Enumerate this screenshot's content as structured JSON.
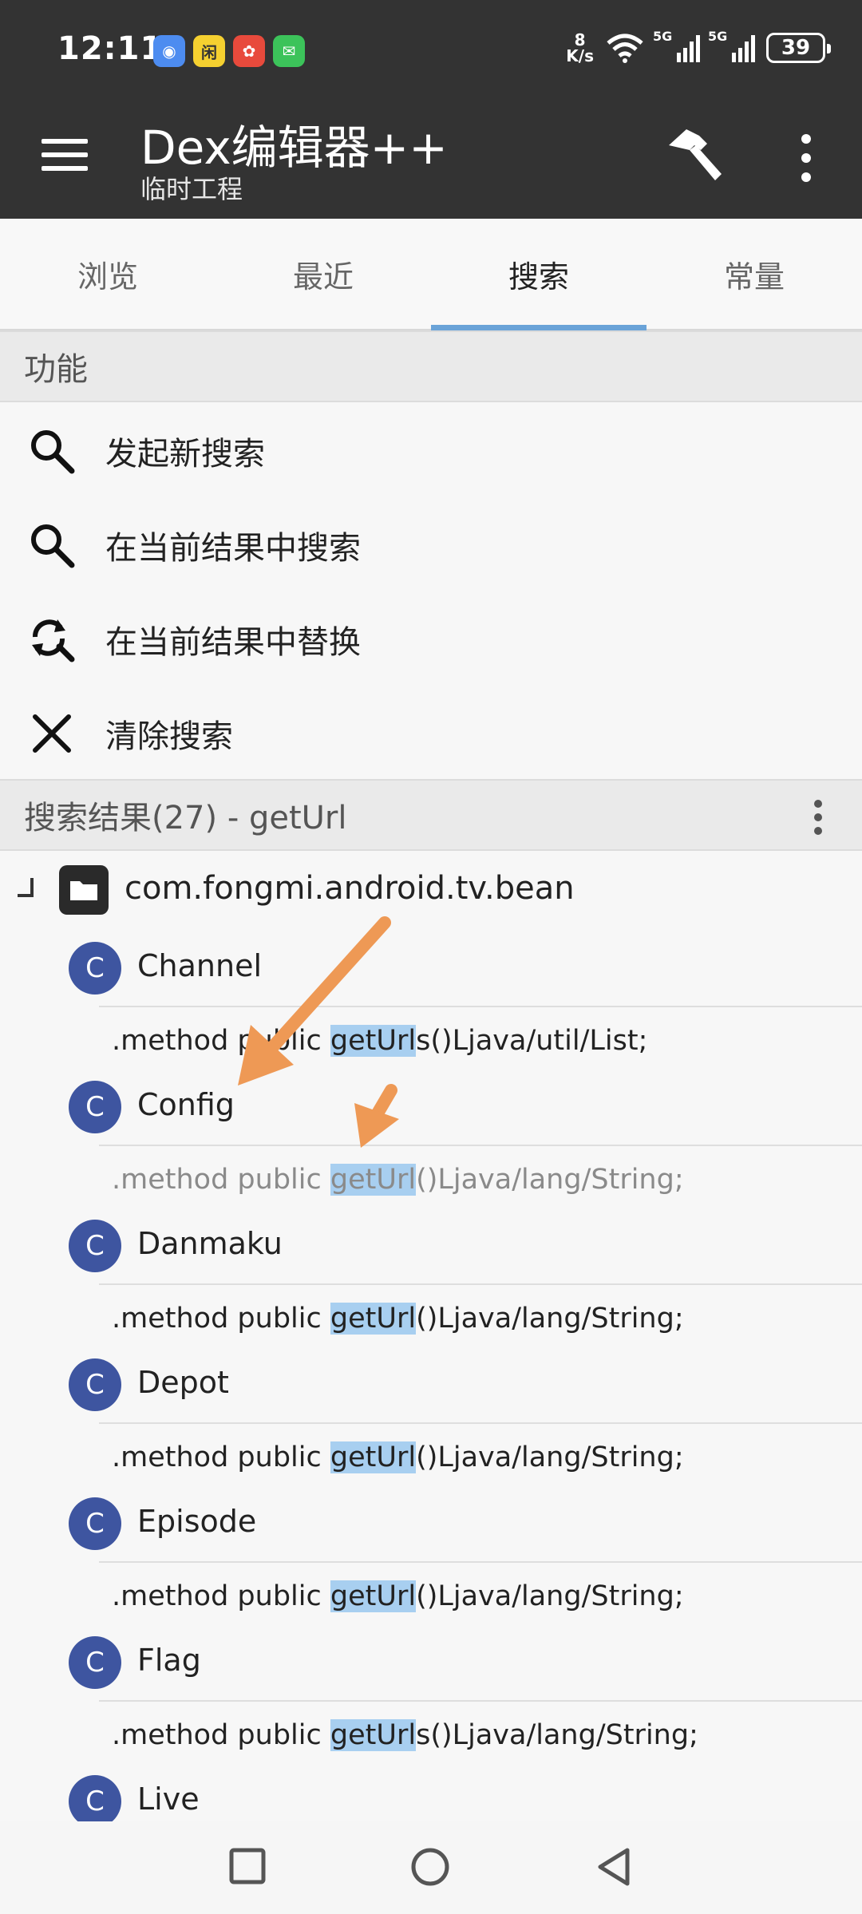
{
  "status": {
    "time": "12:11",
    "apps": [
      "◉",
      "闲",
      "✿",
      "✉"
    ],
    "net_speed_value": "8",
    "net_speed_unit": "K/s",
    "signal1": "5G",
    "signal2": "5G",
    "battery": "39"
  },
  "appbar": {
    "title": "Dex编辑器++",
    "subtitle": "临时工程"
  },
  "tabs": [
    {
      "label": "浏览"
    },
    {
      "label": "最近"
    },
    {
      "label": "搜索",
      "active": true
    },
    {
      "label": "常量"
    }
  ],
  "functions": {
    "header": "功能",
    "items": [
      {
        "label": "发起新搜索",
        "icon": "search-icon"
      },
      {
        "label": "在当前结果中搜索",
        "icon": "search-icon"
      },
      {
        "label": "在当前结果中替换",
        "icon": "search-replace-icon"
      },
      {
        "label": "清除搜索",
        "icon": "close-icon"
      }
    ]
  },
  "results": {
    "header": "搜索结果(27) - getUrl",
    "package": "com.fongmi.android.tv.bean",
    "classes": [
      {
        "badge": "C",
        "name": "Channel",
        "method": {
          "prefix": ".method public ",
          "hl": "getUrl",
          "suffix": "s()Ljava/util/List;"
        }
      },
      {
        "badge": "C",
        "name": "Config",
        "method": {
          "prefix": ".method public ",
          "hl": "getUrl",
          "suffix": "()Ljava/lang/String;"
        }
      },
      {
        "badge": "C",
        "name": "Danmaku",
        "method": {
          "prefix": ".method public ",
          "hl": "getUrl",
          "suffix": "()Ljava/lang/String;"
        }
      },
      {
        "badge": "C",
        "name": "Depot",
        "method": {
          "prefix": ".method public ",
          "hl": "getUrl",
          "suffix": "()Ljava/lang/String;"
        }
      },
      {
        "badge": "C",
        "name": "Episode",
        "method": {
          "prefix": ".method public ",
          "hl": "getUrl",
          "suffix": "()Ljava/lang/String;"
        }
      },
      {
        "badge": "C",
        "name": "Flag",
        "method": {
          "prefix": ".method public ",
          "hl": "getUrl",
          "suffix": "s()Ljava/lang/String;"
        }
      },
      {
        "badge": "C",
        "name": "Live"
      }
    ]
  },
  "colors": {
    "appbar": "#333333",
    "accent": "#6aa3d8",
    "class_badge": "#3e55a0",
    "highlight": "#a8cff0",
    "annotation_arrow": "#ee9955"
  }
}
